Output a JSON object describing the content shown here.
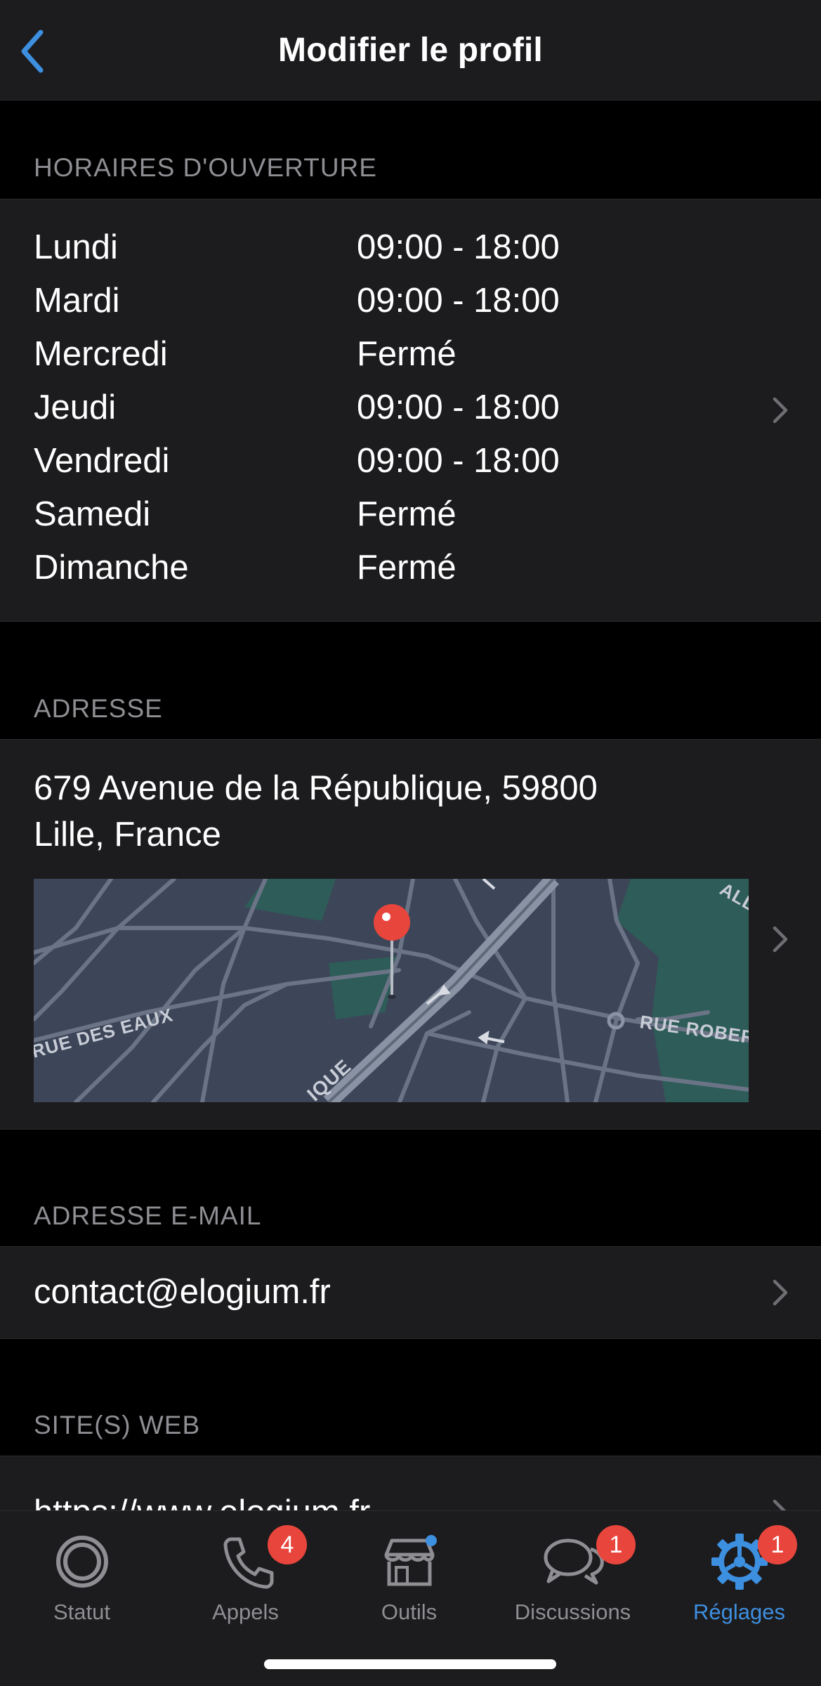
{
  "nav": {
    "title": "Modifier le profil"
  },
  "hours": {
    "header": "HORAIRES D'OUVERTURE",
    "rows": [
      {
        "day": "Lundi",
        "time": "09:00 - 18:00"
      },
      {
        "day": "Mardi",
        "time": "09:00 - 18:00"
      },
      {
        "day": "Mercredi",
        "time": "Fermé"
      },
      {
        "day": "Jeudi",
        "time": "09:00 - 18:00"
      },
      {
        "day": "Vendredi",
        "time": "09:00 - 18:00"
      },
      {
        "day": "Samedi",
        "time": "Fermé"
      },
      {
        "day": "Dimanche",
        "time": "Fermé"
      }
    ]
  },
  "address": {
    "header": "ADRESSE",
    "line1": "679 Avenue de la République, 59800",
    "line2": "Lille, France",
    "map_labels": {
      "street1": "RUE DES EAUX",
      "street2": "RUE ROBER",
      "street3": "IQUE",
      "street4": "ALL"
    }
  },
  "email": {
    "header": "ADRESSE E-MAIL",
    "value": "contact@elogium.fr"
  },
  "web": {
    "header": "SITE(S) WEB",
    "value": "https://www.elogium.fr"
  },
  "tabs": [
    {
      "label": "Statut",
      "icon": "status-icon",
      "badge": ""
    },
    {
      "label": "Appels",
      "icon": "phone-icon",
      "badge": "4"
    },
    {
      "label": "Outils",
      "icon": "store-icon",
      "badge": ""
    },
    {
      "label": "Discussions",
      "icon": "chat-bubbles-icon",
      "badge": "1"
    },
    {
      "label": "Réglages",
      "icon": "settings-icon",
      "badge": "1",
      "active": true
    }
  ],
  "colors": {
    "accent": "#3d8fe0",
    "badge": "#e8453c",
    "cell": "#1c1c1e",
    "header_text": "#8e8e93"
  }
}
